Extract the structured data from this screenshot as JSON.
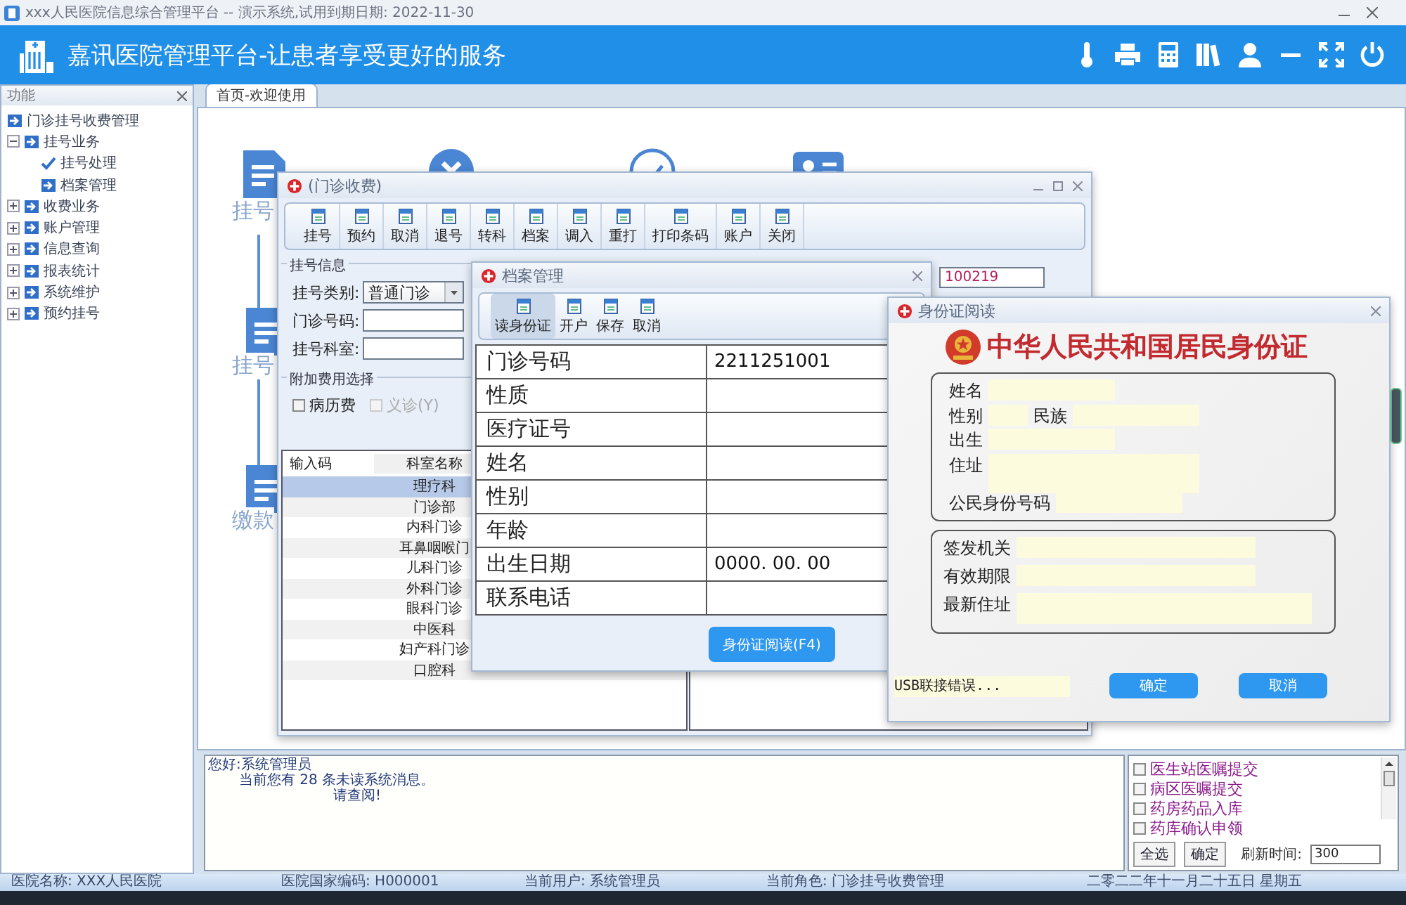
{
  "window": {
    "title": "xxx人民医院信息综合管理平台 -- 演示系统,试用到期日期: 2022-11-30"
  },
  "header": {
    "title": "嘉讯医院管理平台-让患者享受更好的服务"
  },
  "sidebar": {
    "title": "功能",
    "tree": [
      {
        "label": "门诊挂号收费管理",
        "children": [
          {
            "label": "挂号业务",
            "expanded": true,
            "children": [
              {
                "label": "挂号处理",
                "selected": true
              },
              {
                "label": "档案管理",
                "selected": false
              }
            ]
          },
          {
            "label": "收费业务",
            "expanded": false
          },
          {
            "label": "账户管理",
            "expanded": false
          },
          {
            "label": "信息查询",
            "expanded": false
          },
          {
            "label": "报表统计",
            "expanded": false
          },
          {
            "label": "系统维护",
            "expanded": false
          },
          {
            "label": "预约挂号",
            "expanded": false
          }
        ]
      }
    ]
  },
  "tabs": [
    {
      "label": "首页-欢迎使用",
      "selected": true
    }
  ],
  "home_shortcuts": [
    {
      "label": "挂号"
    },
    {
      "label": "挂号"
    },
    {
      "label": "缴款"
    }
  ],
  "outpatient_window": {
    "title": "(门诊收费)",
    "toolbar": [
      "挂号",
      "预约",
      "取消",
      "退号",
      "转科",
      "档案",
      "调入",
      "重打",
      "打印条码",
      "账户",
      "关闭"
    ],
    "registration": {
      "legend": "挂号信息",
      "fields": [
        {
          "label": "挂号类别:",
          "kind": "dropdown",
          "value": "普通门诊"
        },
        {
          "label": "门诊号码:",
          "kind": "text"
        },
        {
          "label": "挂号科室:",
          "kind": "text"
        }
      ]
    },
    "number_value": "100219",
    "extra_fees": {
      "legend": "附加费用选择",
      "options": [
        {
          "label": "病历费",
          "checked": false,
          "disabled": false
        },
        {
          "label": "义诊(Y)",
          "checked": false,
          "disabled": true
        }
      ]
    },
    "departments": {
      "columns": [
        "输入码",
        "科室名称"
      ],
      "rows": [
        {
          "name": "理疗科",
          "selected": true
        },
        {
          "name": "门诊部",
          "selected": false
        },
        {
          "name": "内科门诊",
          "selected": false
        },
        {
          "name": "耳鼻咽喉门",
          "selected": false
        },
        {
          "name": "儿科门诊",
          "selected": false
        },
        {
          "name": "外科门诊",
          "selected": false
        },
        {
          "name": "眼科门诊",
          "selected": false
        },
        {
          "name": "中医科",
          "selected": false
        },
        {
          "name": "妇产科门诊",
          "selected": false
        },
        {
          "name": "口腔科",
          "selected": false
        }
      ]
    }
  },
  "archive_window": {
    "title": "档案管理",
    "toolbar": [
      {
        "label": "读身份证",
        "selected": true
      },
      {
        "label": "开户",
        "selected": false
      },
      {
        "label": "保存",
        "selected": false
      },
      {
        "label": "取消",
        "selected": false
      }
    ],
    "fields": [
      {
        "label": "门诊号码",
        "value": "2211251001"
      },
      {
        "label": "性质"
      },
      {
        "label": "医疗证号"
      },
      {
        "label": "姓名"
      },
      {
        "label": "性别"
      },
      {
        "label": "年龄"
      },
      {
        "label": "出生日期",
        "value": "0000. 00. 00"
      },
      {
        "label": "联系电话"
      }
    ],
    "button": "身份证阅读(F4)"
  },
  "id_card_window": {
    "title": "身份证阅读",
    "heading": "中华人民共和国居民身份证",
    "front_rows": [
      {
        "fields": [
          {
            "label": "姓名",
            "kind": "line"
          }
        ]
      },
      {
        "fields": [
          {
            "label": "性别",
            "kind": "short"
          },
          {
            "label": "民族",
            "kind": "line"
          }
        ]
      },
      {
        "fields": [
          {
            "label": "出生",
            "kind": "line"
          }
        ]
      },
      {
        "fields": [
          {
            "label": "住址",
            "kind": "multiline"
          }
        ]
      },
      {
        "fields": [
          {
            "label": "公民身份号码",
            "kind": "line"
          }
        ]
      }
    ],
    "back_fields": [
      {
        "label": "签发机关",
        "kind": "line"
      },
      {
        "label": "有效期限",
        "kind": "line"
      },
      {
        "label": "最新住址",
        "kind": "wide"
      }
    ],
    "status": "USB联接错误...",
    "buttons": [
      "确定",
      "取消"
    ]
  },
  "messages": {
    "lines": [
      "您好:系统管理员",
      "当前您有  28  条未读系统消息。",
      "请查阅!"
    ]
  },
  "notifications": {
    "items": [
      {
        "label": "医生站医嘱提交",
        "checked": false
      },
      {
        "label": "病区医嘱提交",
        "checked": false
      },
      {
        "label": "药房药品入库",
        "checked": false
      },
      {
        "label": "药库确认申领",
        "checked": false
      }
    ],
    "buttons": [
      "全选",
      "确定"
    ],
    "refresh_label": "刷新时间:",
    "refresh_value": "300"
  },
  "status_bar": [
    "医院名称: XXX人民医院",
    "医院国家编码: H000001",
    "当前用户: 系统管理员",
    "当前角色: 门诊挂号收费管理",
    "二零二二年十一月二十五日 星期五"
  ]
}
